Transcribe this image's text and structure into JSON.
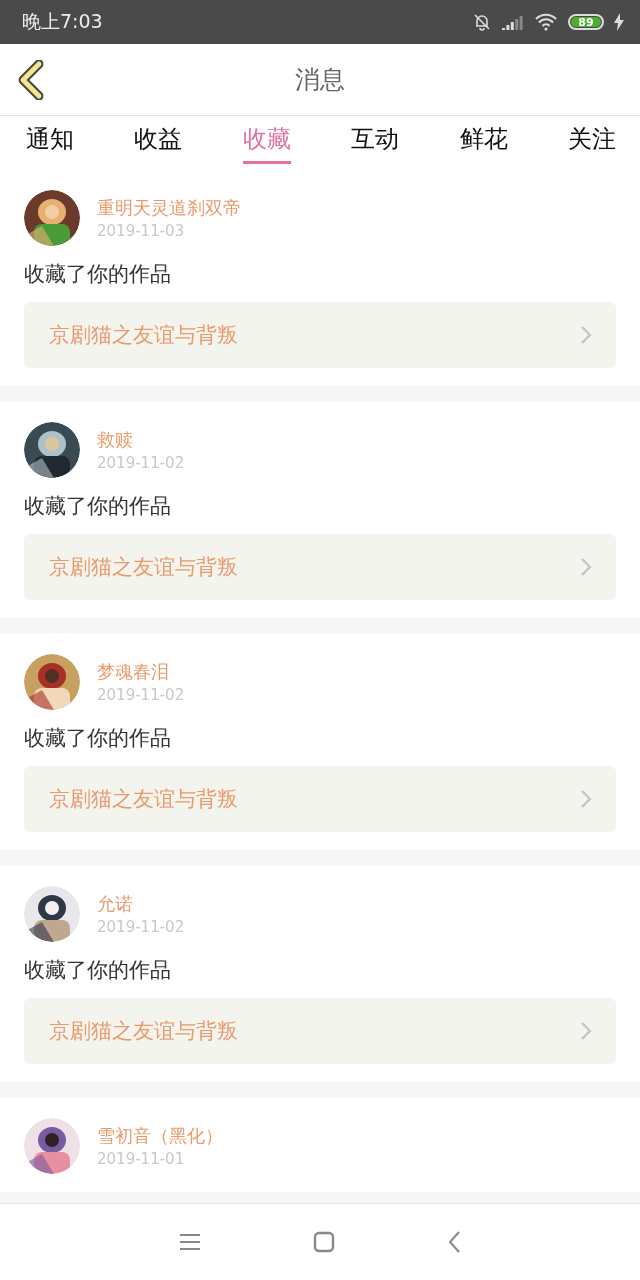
{
  "status_bar": {
    "time": "晚上7:03",
    "battery": "89"
  },
  "header": {
    "title": "消息"
  },
  "tabs": [
    {
      "label": "通知",
      "selected": false
    },
    {
      "label": "收益",
      "selected": false
    },
    {
      "label": "收藏",
      "selected": true
    },
    {
      "label": "互动",
      "selected": false
    },
    {
      "label": "鲜花",
      "selected": false
    },
    {
      "label": "关注",
      "selected": false
    }
  ],
  "messages": [
    {
      "name": "重明天灵道刹双帝",
      "date": "2019-11-03",
      "text": "收藏了你的作品",
      "work": "京剧猫之友谊与背叛"
    },
    {
      "name": "救赎",
      "date": "2019-11-02",
      "text": "收藏了你的作品",
      "work": "京剧猫之友谊与背叛"
    },
    {
      "name": "梦魂春泪",
      "date": "2019-11-02",
      "text": "收藏了你的作品",
      "work": "京剧猫之友谊与背叛"
    },
    {
      "name": "允诺",
      "date": "2019-11-02",
      "text": "收藏了你的作品",
      "work": "京剧猫之友谊与背叛"
    },
    {
      "name": "雪初音（黑化）",
      "date": "2019-11-01"
    }
  ]
}
